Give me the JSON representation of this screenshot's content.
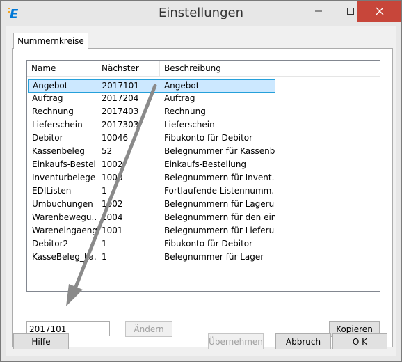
{
  "window": {
    "title": "Einstellungen",
    "app_icon_letter": "E",
    "accent": "#0078d7",
    "close_color": "#c7463a"
  },
  "tabs": [
    {
      "label": "Nummernkreise"
    }
  ],
  "list": {
    "columns": [
      "Name",
      "Nächster Wert",
      "Beschreibung"
    ],
    "rows": [
      {
        "name": "Angebot",
        "next": "2017101",
        "desc": "Angebot"
      },
      {
        "name": "Auftrag",
        "next": "2017204",
        "desc": "Auftrag"
      },
      {
        "name": "Rechnung",
        "next": "2017403",
        "desc": "Rechnung"
      },
      {
        "name": "Lieferschein",
        "next": "2017303",
        "desc": "Lieferschein"
      },
      {
        "name": "Debitor",
        "next": "10046",
        "desc": "Fibukonto für Debitor"
      },
      {
        "name": "Kassenbeleg",
        "next": "52",
        "desc": "Belegnummer für Kassenb..."
      },
      {
        "name": "Einkaufs-Bestel...",
        "next": "1002",
        "desc": "Einkaufs-Bestellung"
      },
      {
        "name": "Inventurbelege",
        "next": "1000",
        "desc": "Belegnummern für Invent..."
      },
      {
        "name": "EDIListen",
        "next": "1",
        "desc": "Fortlaufende Listennumm..."
      },
      {
        "name": "Umbuchungen",
        "next": "1002",
        "desc": "Belegnummern für Lageru..."
      },
      {
        "name": "Warenbewegu...",
        "next": "1004",
        "desc": "Belegnummern für den ein..."
      },
      {
        "name": "Wareneingaenge",
        "next": "1001",
        "desc": "Belegnummern für Lieferu..."
      },
      {
        "name": "Debitor2",
        "next": "1",
        "desc": "Fibukonto für Debitor"
      },
      {
        "name": "KasseBeleg_La...",
        "next": "1",
        "desc": "Belegnummer für Lager"
      }
    ],
    "selected_index": 0
  },
  "editor": {
    "value": "2017101",
    "change_label": "Ändern",
    "copy_label": "Kopieren"
  },
  "footer": {
    "help_label": "Hilfe",
    "apply_label": "Übernehmen",
    "cancel_label": "Abbruch",
    "ok_label": "O K"
  }
}
